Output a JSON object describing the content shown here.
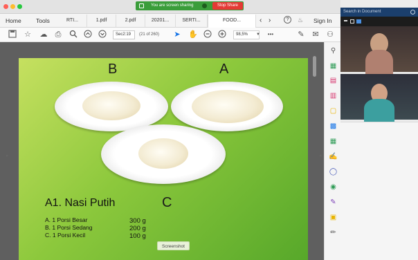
{
  "colors": {
    "share_green": "#3a9d3a",
    "stop_red": "#e53935",
    "zoom_bar": "#1b3f6d",
    "page_green": "#8cc83c"
  },
  "screen_share": {
    "message": "You are screen sharing",
    "stop_label": "Stop Share"
  },
  "acrobat": {
    "menu": {
      "home": "Home",
      "tools": "Tools"
    },
    "tabs": [
      {
        "label": "RTI...",
        "active": false
      },
      {
        "label": "1.pdf",
        "active": false
      },
      {
        "label": "2.pdf",
        "active": false
      },
      {
        "label": "20201...",
        "active": false
      },
      {
        "label": "SERTI...",
        "active": false
      },
      {
        "label": "FOOD...",
        "active": true
      }
    ],
    "sign_in": "Sign In",
    "page_input": "Sec2:19",
    "page_of": "(21 of 260)",
    "zoom_level": "98,5%",
    "more": "•••"
  },
  "document": {
    "letters": {
      "b": "B",
      "a": "A",
      "c": "C"
    },
    "title": "A1. Nasi Putih",
    "portions": [
      {
        "label": "A. 1 Porsi Besar",
        "weight": "300 g"
      },
      {
        "label": "B. 1 Porsi Sedang",
        "weight": "200 g"
      },
      {
        "label": "C. 1 Porsi Kecil",
        "weight": "100 g"
      }
    ],
    "screenshot_tip": "Screenshot"
  },
  "zoom": {
    "search_placeholder": "Search in Document"
  },
  "icons": [
    "close-dot",
    "minimize-dot",
    "zoom-dot",
    "monitor-icon",
    "pause-icon",
    "save-icon",
    "star-icon",
    "upload-cloud-icon",
    "print-icon",
    "search-zoom-icon",
    "page-up-icon",
    "page-down-icon",
    "select-cursor-icon",
    "hand-icon",
    "zoom-out-icon",
    "zoom-in-icon",
    "dropdown-icon",
    "sign-icon",
    "mail-icon",
    "share-user-icon",
    "help-icon",
    "bell-icon",
    "chevron-left-icon",
    "chevron-right-icon"
  ]
}
